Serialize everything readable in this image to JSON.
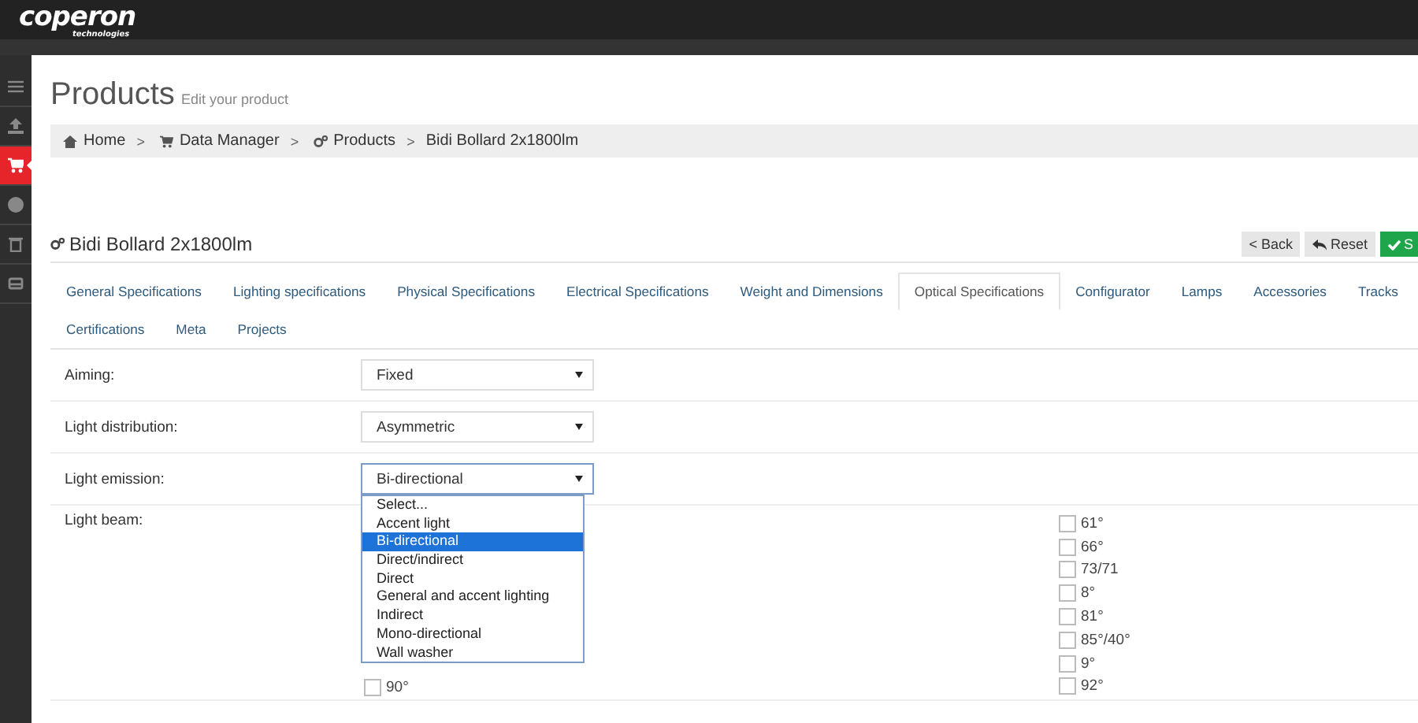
{
  "header": {
    "logo": "coperon",
    "logo_sub": "technologies"
  },
  "sidebar": {
    "items": [
      {
        "kind": "menu",
        "selected": false
      },
      {
        "kind": "upload",
        "selected": false
      },
      {
        "kind": "cart",
        "selected": true
      },
      {
        "kind": "globe",
        "selected": false
      },
      {
        "kind": "trash",
        "selected": false
      },
      {
        "kind": "inbox",
        "selected": false
      }
    ]
  },
  "page": {
    "title": "Products",
    "subtitle": "Edit your product"
  },
  "breadcrumb": [
    {
      "kind": "home",
      "label": "Home"
    },
    {
      "kind": "cart",
      "label": "Data Manager"
    },
    {
      "kind": "gears",
      "label": "Products"
    },
    {
      "kind": "plain",
      "label": "Bidi Bollard 2x1800lm"
    }
  ],
  "breadcrumb_separator": ">",
  "product": {
    "title": "Bidi Bollard 2x1800lm"
  },
  "buttons": [
    {
      "kind": "back",
      "label": "< Back"
    },
    {
      "kind": "reset",
      "label": "Reset"
    },
    {
      "kind": "save",
      "label": "S"
    }
  ],
  "tabs": [
    {
      "label": "General Specifications",
      "selected": false
    },
    {
      "label": "Lighting specifications",
      "selected": false
    },
    {
      "label": "Physical Specifications",
      "selected": false
    },
    {
      "label": "Electrical Specifications",
      "selected": false
    },
    {
      "label": "Weight and Dimensions",
      "selected": false
    },
    {
      "label": "Optical Specifications",
      "selected": true
    },
    {
      "label": "Configurator",
      "selected": false
    },
    {
      "label": "Lamps",
      "selected": false
    },
    {
      "label": "Accessories",
      "selected": false
    },
    {
      "label": "Tracks",
      "selected": false
    },
    {
      "label": "Certifications",
      "selected": false
    },
    {
      "label": "Meta",
      "selected": false
    },
    {
      "label": "Projects",
      "selected": false
    }
  ],
  "fields": [
    {
      "kind": "select",
      "label": "Aiming:",
      "value": "Fixed",
      "expanded": false
    },
    {
      "kind": "select",
      "label": "Light distribution:",
      "value": "Asymmetric",
      "expanded": false
    },
    {
      "kind": "select",
      "label": "Light emission:",
      "value": "Bi-directional",
      "expanded": true,
      "options": [
        {
          "label": "Select...",
          "selected": false
        },
        {
          "label": "Accent light",
          "selected": false
        },
        {
          "label": "Bi-directional",
          "selected": true
        },
        {
          "label": "Direct/indirect",
          "selected": false
        },
        {
          "label": "Direct",
          "selected": false
        },
        {
          "label": "General and accent lighting",
          "selected": false
        },
        {
          "label": "Indirect",
          "selected": false
        },
        {
          "label": "Mono-directional",
          "selected": false
        },
        {
          "label": "Wall washer",
          "selected": false
        }
      ]
    },
    {
      "kind": "checkboxes",
      "label": "Light beam:",
      "columns": [
        [
          {
            "label": "90°",
            "checked": false
          }
        ],
        [
          {
            "label": "61°",
            "checked": false
          },
          {
            "label": "66°",
            "checked": false
          },
          {
            "label": "73/71",
            "checked": false
          },
          {
            "label": "8°",
            "checked": false
          },
          {
            "label": "81°",
            "checked": false
          },
          {
            "label": "85°/40°",
            "checked": false
          },
          {
            "label": "9°",
            "checked": false
          },
          {
            "label": "92°",
            "checked": false
          }
        ]
      ]
    }
  ]
}
